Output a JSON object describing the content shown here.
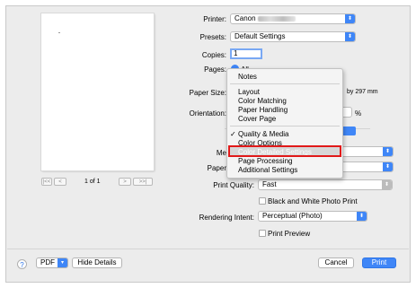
{
  "printer": {
    "label": "Printer:",
    "value": "Canon"
  },
  "presets": {
    "label": "Presets:",
    "value": "Default Settings"
  },
  "copies": {
    "label": "Copies:",
    "value": "1"
  },
  "pages": {
    "label": "Pages:",
    "value": "All"
  },
  "paper_size": {
    "label": "Paper Size:",
    "value_tail": "by 297 mm"
  },
  "orientation": {
    "label": "Orientation:",
    "scale_unit": "%"
  },
  "preview_pager": {
    "first": "|<<",
    "prev": "<",
    "page_info": "1 of 1",
    "next": ">",
    "last": ">>|"
  },
  "media_row": {
    "label": "Me"
  },
  "paper_row": {
    "label": "Paper"
  },
  "print_quality": {
    "label": "Print Quality:",
    "value": "Fast"
  },
  "bw_photo": {
    "label": "Black and White Photo Print",
    "checked": false
  },
  "rendering_intent": {
    "label": "Rendering Intent:",
    "value": "Perceptual (Photo)"
  },
  "print_preview": {
    "label": "Print Preview",
    "checked": false
  },
  "menu": {
    "items": [
      {
        "label": "Notes",
        "checked": false
      },
      {
        "label": "Layout",
        "checked": false
      },
      {
        "label": "Color Matching",
        "checked": false
      },
      {
        "label": "Paper Handling",
        "checked": false
      },
      {
        "label": "Cover Page",
        "checked": false
      },
      {
        "label": "Quality & Media",
        "checked": true
      },
      {
        "label": "Color Options",
        "checked": false
      },
      {
        "label": "Color Detailed Settings",
        "checked": false,
        "highlighted": true
      },
      {
        "label": "Page Processing",
        "checked": false
      },
      {
        "label": "Additional Settings",
        "checked": false
      }
    ],
    "checkmark": "✓"
  },
  "footer": {
    "help": "?",
    "pdf_label": "PDF",
    "hide_details": "Hide Details",
    "cancel": "Cancel",
    "print": "Print"
  },
  "colors": {
    "accent": "#3f86f7",
    "highlight_box": "#e11919"
  },
  "icons": {
    "popup_arrows": "chevron-up-down-icon",
    "dropdown": "chevron-down-icon"
  }
}
